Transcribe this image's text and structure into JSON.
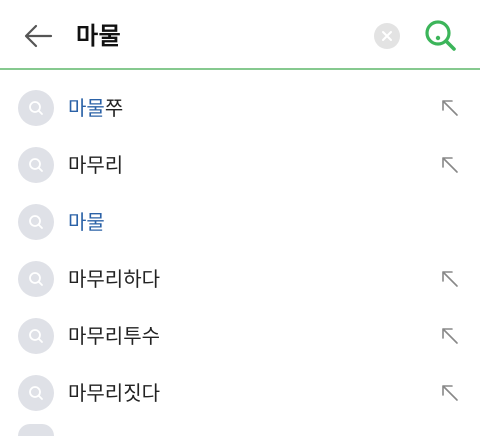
{
  "search": {
    "query": "마물"
  },
  "icons": {
    "back": "arrow-left-icon",
    "clear": "close-icon",
    "search": "search-icon",
    "suggestion": "search-icon",
    "fill": "arrow-up-left-icon"
  },
  "colors": {
    "accent_green": "#3cb55a",
    "highlight_blue": "#2b62a7",
    "divider_green": "#86c98f"
  },
  "suggestions": [
    {
      "match": "마물",
      "rest": "쭈",
      "fill_arrow": true
    },
    {
      "match": "",
      "rest": "마무리",
      "fill_arrow": true
    },
    {
      "match": "마물",
      "rest": "",
      "fill_arrow": false
    },
    {
      "match": "",
      "rest": "마무리하다",
      "fill_arrow": true
    },
    {
      "match": "",
      "rest": "마무리투수",
      "fill_arrow": true
    },
    {
      "match": "",
      "rest": "마무리짓다",
      "fill_arrow": true
    }
  ]
}
